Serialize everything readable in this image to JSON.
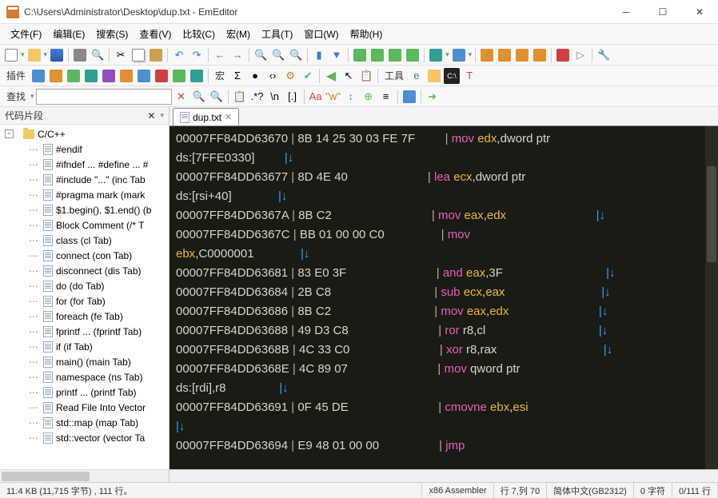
{
  "window": {
    "title": "C:\\Users\\Administrator\\Desktop\\dup.txt - EmEditor"
  },
  "menu": [
    "文件(F)",
    "编辑(E)",
    "搜索(S)",
    "查看(V)",
    "比较(C)",
    "宏(M)",
    "工具(T)",
    "窗口(W)",
    "帮助(H)"
  ],
  "toolbar2": {
    "plugin_label": "插件",
    "macro_label": "宏",
    "tools_label": "工具"
  },
  "toolbar3": {
    "find_label": "查找"
  },
  "sidebar": {
    "title": "代码片段",
    "folder": "C/C++",
    "items": [
      "#endif",
      "#ifndef ... #define ... #",
      "#include \"...\"  (inc Tab",
      "#pragma mark  (mark",
      "$1.begin(), $1.end()  (b",
      "Block Comment  (/* T",
      "class  (cl Tab)",
      "connect  (con Tab)",
      "disconnect  (dis Tab)",
      "do  (do Tab)",
      "for  (for Tab)",
      "foreach  (fe Tab)",
      "fprintf ...  (fprintf Tab)",
      "if  (if Tab)",
      "main()  (main Tab)",
      "namespace  (ns Tab)",
      "printf ...  (printf Tab)",
      "Read File Into Vector",
      "std::map  (map Tab)",
      "std::vector  (vector Ta"
    ]
  },
  "tab": {
    "name": "dup.txt"
  },
  "code": {
    "lines": [
      [
        [
          "addr",
          "00007FF84DD63670"
        ],
        [
          "pipe",
          " | "
        ],
        [
          "hex",
          "8B 14 25 30 03 FE 7F"
        ],
        [
          "sp",
          "         "
        ],
        [
          "pipe",
          "| "
        ],
        [
          "mn",
          "mov"
        ],
        [
          "sp",
          " "
        ],
        [
          "reg",
          "edx"
        ],
        [
          "punc",
          ","
        ],
        [
          "txt",
          "dword ptr"
        ]
      ],
      [
        [
          "txt",
          "ds:[7FFE0330]"
        ],
        [
          "sp",
          "         "
        ],
        [
          "arr",
          "|↓"
        ]
      ],
      [
        [
          "addr",
          "00007FF84DD63677"
        ],
        [
          "pipe",
          " | "
        ],
        [
          "hex",
          "8D 4E 40"
        ],
        [
          "sp",
          "                        "
        ],
        [
          "pipe",
          "| "
        ],
        [
          "mn",
          "lea"
        ],
        [
          "sp",
          " "
        ],
        [
          "reg",
          "ecx"
        ],
        [
          "punc",
          ","
        ],
        [
          "txt",
          "dword ptr"
        ]
      ],
      [
        [
          "txt",
          "ds:[rsi+40]"
        ],
        [
          "sp",
          "              "
        ],
        [
          "arr",
          "|↓"
        ]
      ],
      [
        [
          "addr",
          "00007FF84DD6367A"
        ],
        [
          "pipe",
          " | "
        ],
        [
          "hex",
          "8B C2"
        ],
        [
          "sp",
          "                              "
        ],
        [
          "pipe",
          "| "
        ],
        [
          "mn",
          "mov"
        ],
        [
          "sp",
          " "
        ],
        [
          "reg",
          "eax"
        ],
        [
          "punc",
          ","
        ],
        [
          "reg",
          "edx"
        ],
        [
          "sp",
          "                           "
        ],
        [
          "arr",
          "|↓"
        ]
      ],
      [
        [
          "addr",
          "00007FF84DD6367C"
        ],
        [
          "pipe",
          " | "
        ],
        [
          "hex",
          "BB 01 00 00 C0"
        ],
        [
          "sp",
          "                 "
        ],
        [
          "pipe",
          "| "
        ],
        [
          "mn",
          "mov"
        ]
      ],
      [
        [
          "reg",
          "ebx"
        ],
        [
          "punc",
          ","
        ],
        [
          "txt",
          "C0000001"
        ],
        [
          "sp",
          "              "
        ],
        [
          "arr",
          "|↓"
        ]
      ],
      [
        [
          "addr",
          "00007FF84DD63681"
        ],
        [
          "pipe",
          " | "
        ],
        [
          "hex",
          "83 E0 3F"
        ],
        [
          "sp",
          "                           "
        ],
        [
          "pipe",
          "| "
        ],
        [
          "mn",
          "and"
        ],
        [
          "sp",
          " "
        ],
        [
          "reg",
          "eax"
        ],
        [
          "punc",
          ","
        ],
        [
          "txt",
          "3F"
        ],
        [
          "sp",
          "                               "
        ],
        [
          "arr",
          "|↓"
        ]
      ],
      [
        [
          "addr",
          "00007FF84DD63684"
        ],
        [
          "pipe",
          " | "
        ],
        [
          "hex",
          "2B C8"
        ],
        [
          "sp",
          "                               "
        ],
        [
          "pipe",
          "| "
        ],
        [
          "mn",
          "sub"
        ],
        [
          "sp",
          " "
        ],
        [
          "reg",
          "ecx"
        ],
        [
          "punc",
          ","
        ],
        [
          "reg",
          "eax"
        ],
        [
          "sp",
          "                             "
        ],
        [
          "arr",
          "|↓"
        ]
      ],
      [
        [
          "addr",
          "00007FF84DD63686"
        ],
        [
          "pipe",
          " | "
        ],
        [
          "hex",
          "8B C2"
        ],
        [
          "sp",
          "                               "
        ],
        [
          "pipe",
          "| "
        ],
        [
          "mn",
          "mov"
        ],
        [
          "sp",
          " "
        ],
        [
          "reg",
          "eax"
        ],
        [
          "punc",
          ","
        ],
        [
          "reg",
          "edx"
        ],
        [
          "sp",
          "                           "
        ],
        [
          "arr",
          "|↓"
        ]
      ],
      [
        [
          "addr",
          "00007FF84DD63688"
        ],
        [
          "pipe",
          " | "
        ],
        [
          "hex",
          "49 D3 C8"
        ],
        [
          "sp",
          "                           "
        ],
        [
          "pipe",
          "| "
        ],
        [
          "mn",
          "ror"
        ],
        [
          "sp",
          " "
        ],
        [
          "txt",
          "r8,cl"
        ],
        [
          "sp",
          "                                  "
        ],
        [
          "arr",
          "|↓"
        ]
      ],
      [
        [
          "addr",
          "00007FF84DD6368B"
        ],
        [
          "pipe",
          " | "
        ],
        [
          "hex",
          "4C 33 C0"
        ],
        [
          "sp",
          "                           "
        ],
        [
          "pipe",
          "| "
        ],
        [
          "mn",
          "xor"
        ],
        [
          "sp",
          " "
        ],
        [
          "txt",
          "r8,rax"
        ],
        [
          "sp",
          "                                "
        ],
        [
          "arr",
          "|↓"
        ]
      ],
      [
        [
          "addr",
          "00007FF84DD6368E"
        ],
        [
          "pipe",
          " | "
        ],
        [
          "hex",
          "4C 89 07"
        ],
        [
          "sp",
          "                           "
        ],
        [
          "pipe",
          "| "
        ],
        [
          "mn",
          "mov"
        ],
        [
          "sp",
          " "
        ],
        [
          "txt",
          "qword ptr"
        ]
      ],
      [
        [
          "txt",
          "ds:[rdi],r8"
        ],
        [
          "sp",
          "                "
        ],
        [
          "arr",
          "|↓"
        ]
      ],
      [
        [
          "addr",
          "00007FF84DD63691"
        ],
        [
          "pipe",
          " | "
        ],
        [
          "hex",
          "0F 45 DE"
        ],
        [
          "sp",
          "                           "
        ],
        [
          "pipe",
          "| "
        ],
        [
          "mn",
          "cmovne"
        ],
        [
          "sp",
          " "
        ],
        [
          "reg",
          "ebx"
        ],
        [
          "punc",
          ","
        ],
        [
          "reg",
          "esi"
        ]
      ],
      [
        [
          "arr",
          "|↓"
        ]
      ],
      [
        [
          "addr",
          "00007FF84DD63694"
        ],
        [
          "pipe",
          " | "
        ],
        [
          "hex",
          "E9 48 01 00 00"
        ],
        [
          "sp",
          "                  "
        ],
        [
          "pipe",
          "| "
        ],
        [
          "mn",
          "jmp"
        ]
      ]
    ]
  },
  "status": {
    "size": "11.4 KB (11,715 字节) , 111 行。",
    "lang": "x86 Assembler",
    "pos": "行 7,列 70",
    "enc": "简体中文(GB2312)",
    "sel": "0 字符",
    "lines": "0/111 行"
  }
}
